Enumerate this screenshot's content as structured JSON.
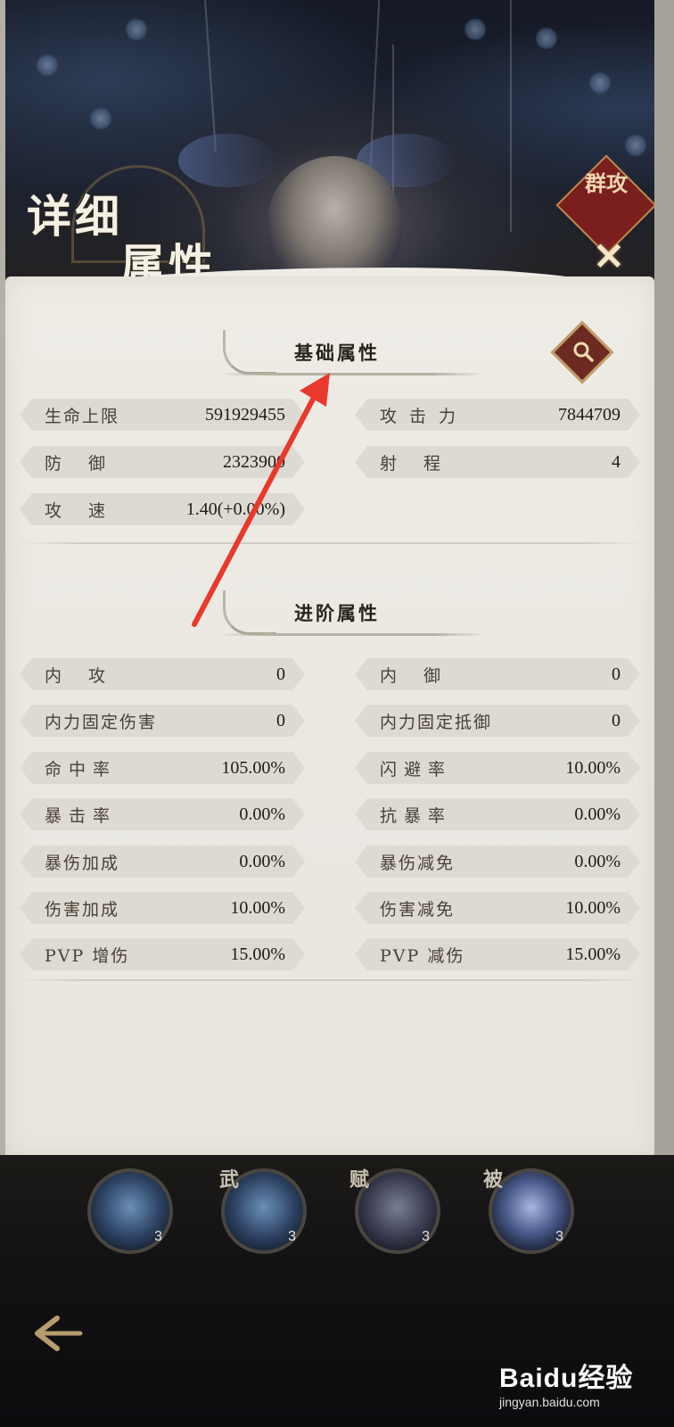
{
  "header": {
    "title_line1": "详细",
    "title_line2": "属性",
    "badge_text": "群攻",
    "close_label": "✕"
  },
  "basic": {
    "title": "基础属性",
    "stats": [
      {
        "label": "生命上限",
        "value": "591929455"
      },
      {
        "label": "攻击力",
        "value": "7844709"
      },
      {
        "label": "防御",
        "value": "2323900"
      },
      {
        "label": "射程",
        "value": "4"
      },
      {
        "label": "攻速",
        "value": "1.40(+0.00%)"
      }
    ]
  },
  "advanced": {
    "title": "进阶属性",
    "stats": [
      {
        "label": "内攻",
        "value": "0"
      },
      {
        "label": "内御",
        "value": "0"
      },
      {
        "label": "内力固定伤害",
        "value": "0"
      },
      {
        "label": "内力固定抵御",
        "value": "0"
      },
      {
        "label": "命中率",
        "value": "105.00%"
      },
      {
        "label": "闪避率",
        "value": "10.00%"
      },
      {
        "label": "暴击率",
        "value": "0.00%"
      },
      {
        "label": "抗暴率",
        "value": "0.00%"
      },
      {
        "label": "暴伤加成",
        "value": "0.00%"
      },
      {
        "label": "暴伤减免",
        "value": "0.00%"
      },
      {
        "label": "伤害加成",
        "value": "10.00%"
      },
      {
        "label": "伤害减免",
        "value": "10.00%"
      },
      {
        "label": "PVP 增伤",
        "value": "15.00%"
      },
      {
        "label": "PVP 减伤",
        "value": "15.00%"
      }
    ]
  },
  "skills": [
    {
      "tag": "",
      "level": "3"
    },
    {
      "tag": "武",
      "level": "3"
    },
    {
      "tag": "赋",
      "level": "3"
    },
    {
      "tag": "被",
      "level": "3"
    }
  ],
  "watermark": {
    "brand": "Baidu经验",
    "site": "jingyan.baidu.com"
  },
  "colors": {
    "panel": "#efece6",
    "stat_bg": "#dddad3",
    "badge": "#7a1e1e",
    "arrow": "#e8392c"
  }
}
